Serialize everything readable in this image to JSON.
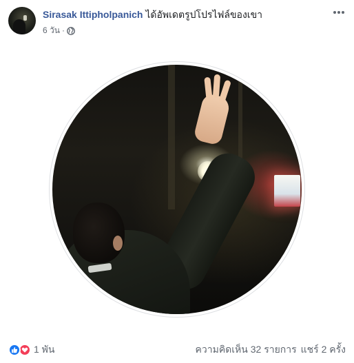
{
  "post": {
    "author": "Sirasak Ittipholpanich",
    "action": "ได้อัพเดตรูปโปรไฟล์ของเขา",
    "time": "6 วัน",
    "separator": "·",
    "privacy_icon": "globe-icon",
    "more_icon": "more-options-icon"
  },
  "footer": {
    "reaction_icons": [
      "like-icon",
      "love-icon"
    ],
    "reaction_count": "1 พัน",
    "comments": "ความคิดเห็น 32 รายการ",
    "shares": "แชร์ 2 ครั้ง"
  },
  "colors": {
    "author_link": "#385898",
    "secondary_text": "#606770",
    "like_blue": "#1877f2",
    "love_red": "#f33e58"
  }
}
